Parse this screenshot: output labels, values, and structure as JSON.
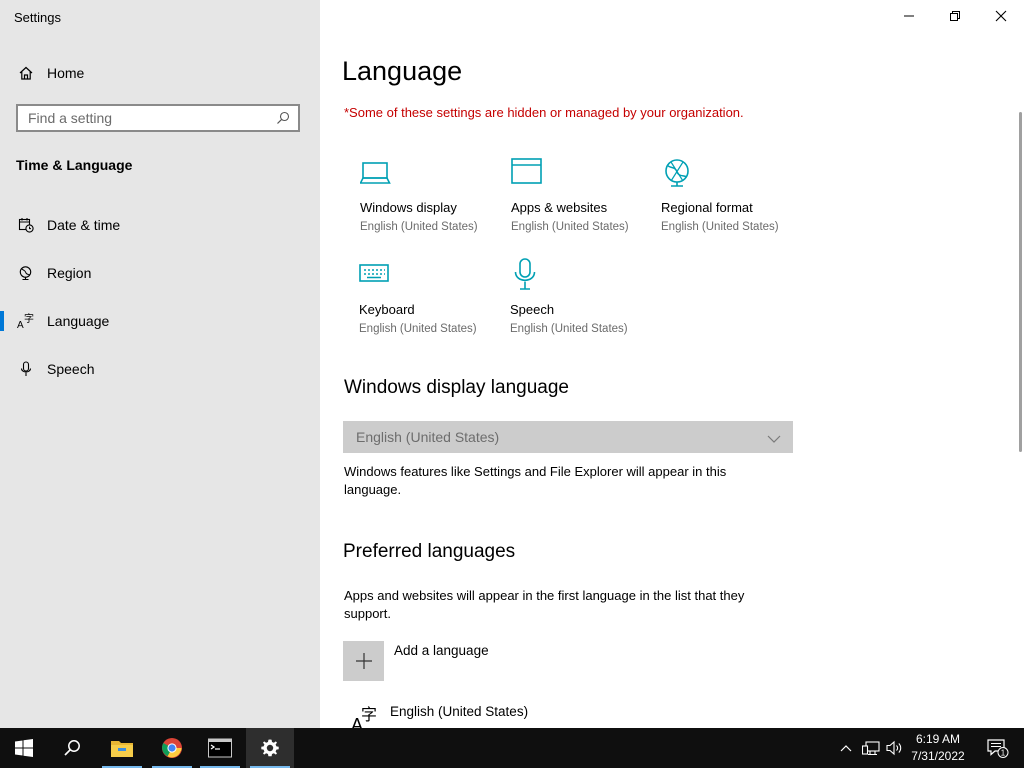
{
  "window": {
    "title": "Settings",
    "controls": {
      "minimize": "minimize",
      "restore": "restore",
      "close": "close"
    }
  },
  "sidebar": {
    "home_label": "Home",
    "search_placeholder": "Find a setting",
    "section_title": "Time & Language",
    "items": [
      {
        "label": "Date & time",
        "icon": "calendar-clock-icon"
      },
      {
        "label": "Region",
        "icon": "globe-icon"
      },
      {
        "label": "Language",
        "icon": "language-icon",
        "active": true
      },
      {
        "label": "Speech",
        "icon": "microphone-icon"
      }
    ]
  },
  "main": {
    "title": "Language",
    "warning": "*Some of these settings are hidden or managed by your organization.",
    "tiles": [
      {
        "name": "Windows display",
        "value": "English (United States)",
        "icon": "laptop-icon"
      },
      {
        "name": "Apps & websites",
        "value": "English (United States)",
        "icon": "browser-window-icon"
      },
      {
        "name": "Regional format",
        "value": "English (United States)",
        "icon": "globe-format-icon"
      },
      {
        "name": "Keyboard",
        "value": "English (United States)",
        "icon": "keyboard-icon"
      },
      {
        "name": "Speech",
        "value": "English (United States)",
        "icon": "microphone-icon"
      }
    ],
    "display_language": {
      "heading": "Windows display language",
      "selected": "English (United States)",
      "description": "Windows features like Settings and File Explorer will appear in this language."
    },
    "preferred": {
      "heading": "Preferred languages",
      "description": "Apps and websites will appear in the first language in the list that they support.",
      "add_label": "Add a language",
      "languages": [
        {
          "name": "English (United States)"
        }
      ]
    }
  },
  "taskbar": {
    "apps": [
      "start",
      "search",
      "file-explorer",
      "chrome",
      "command-prompt",
      "settings"
    ],
    "time": "6:19 AM",
    "date": "7/31/2022",
    "notification_count": "1"
  },
  "colors": {
    "accent": "#0078d7",
    "icon_teal": "#00a0b4",
    "warning": "#c50000"
  }
}
